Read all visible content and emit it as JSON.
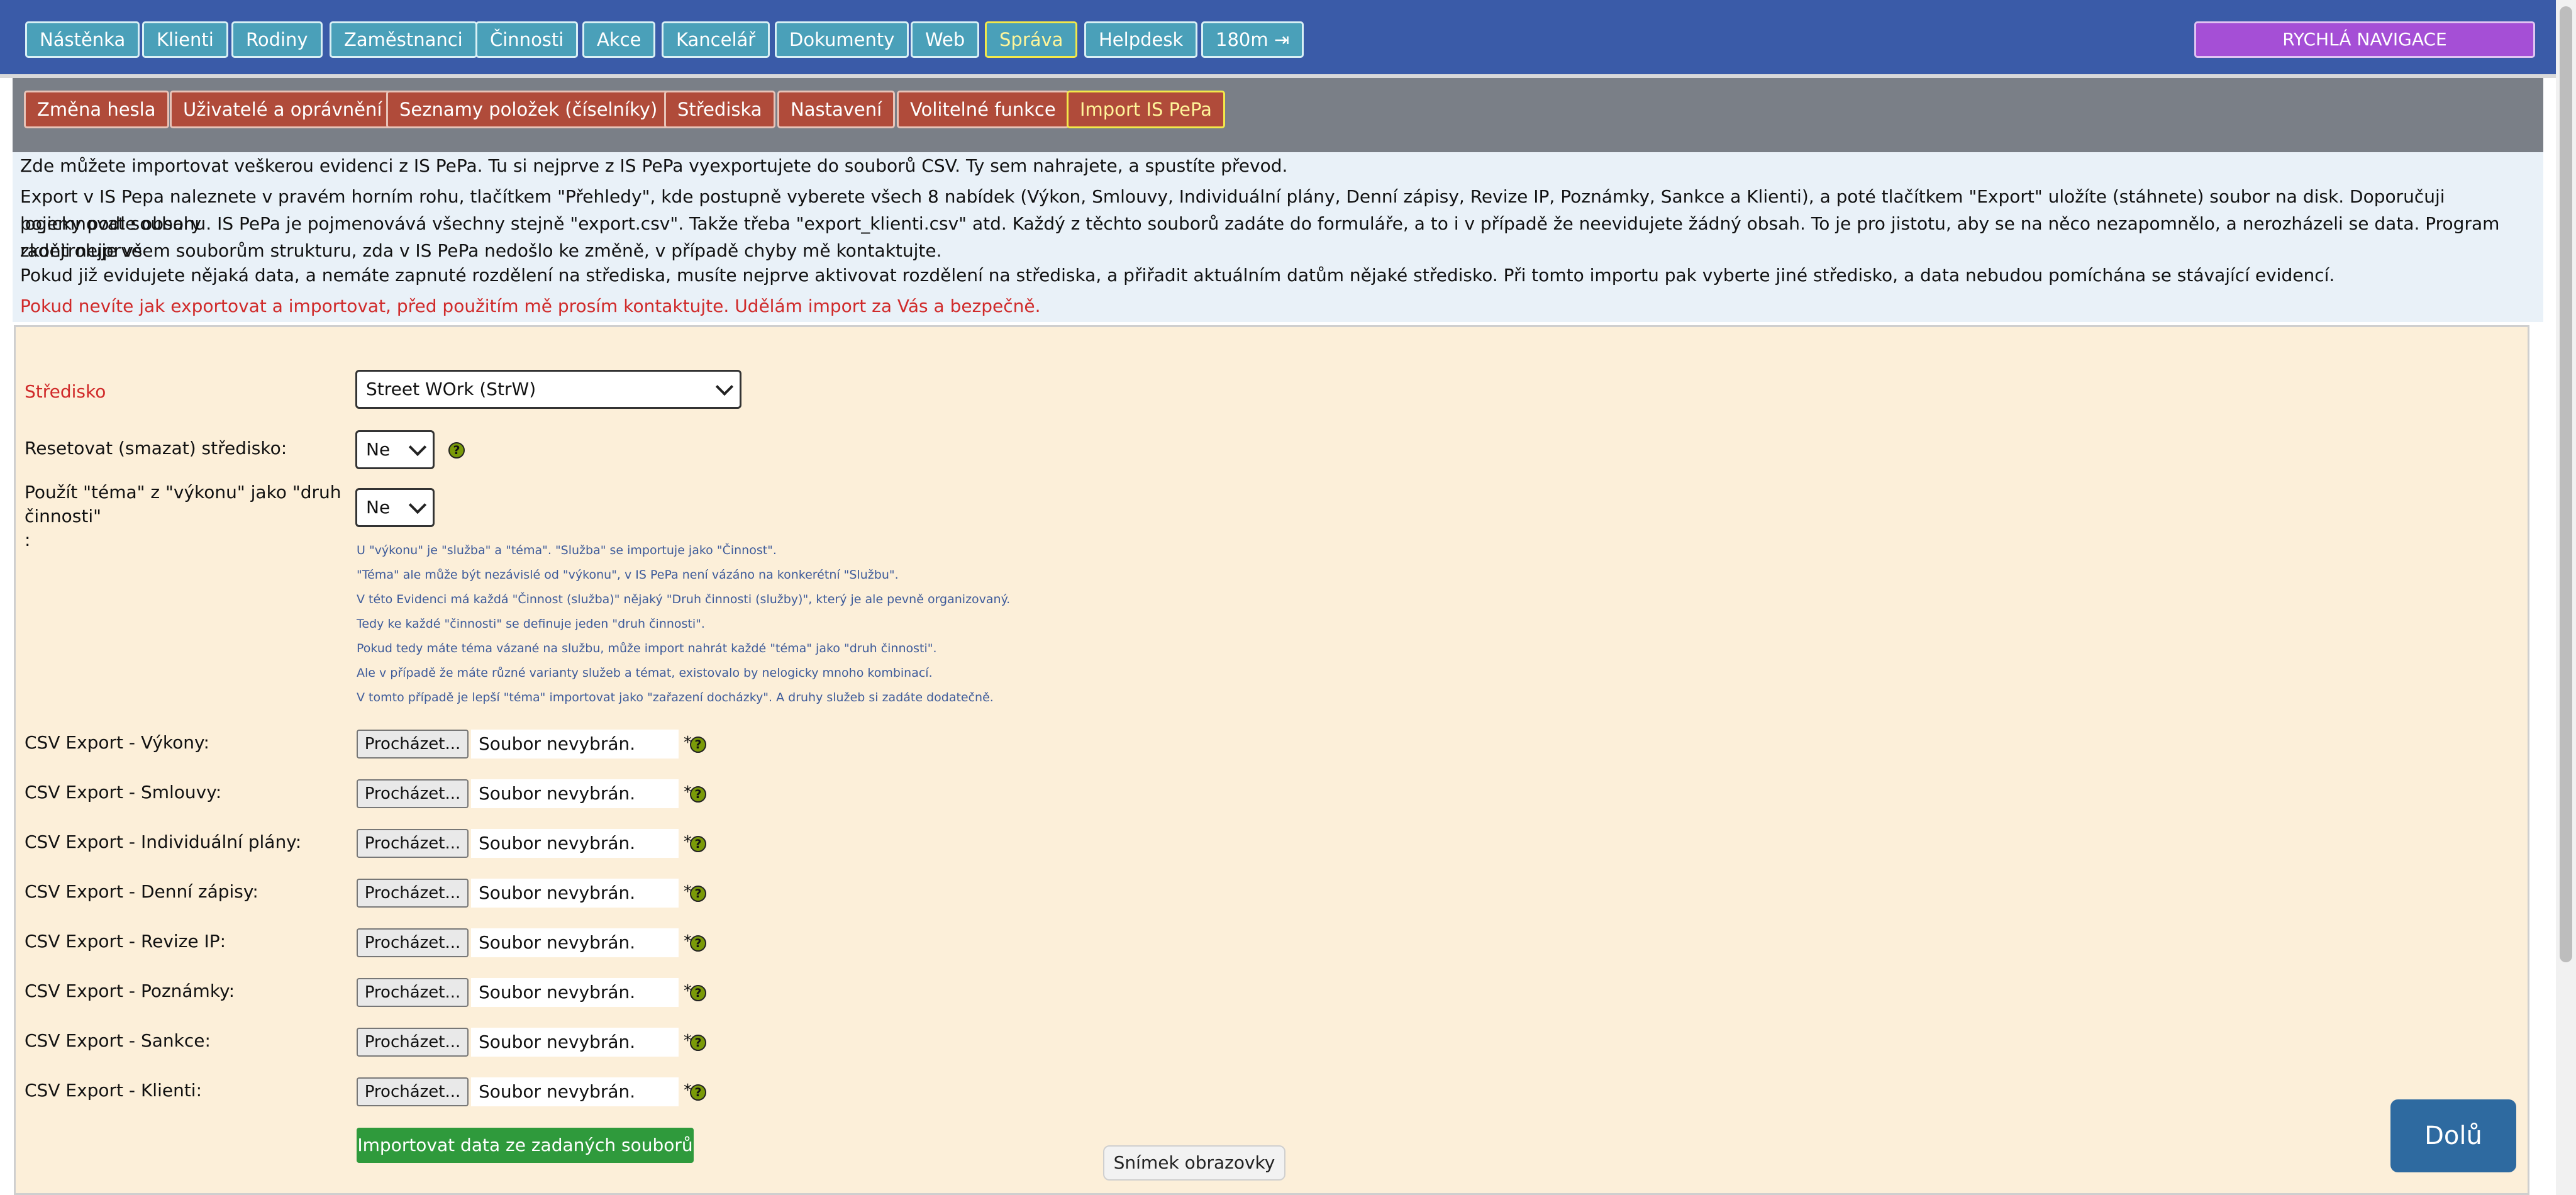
{
  "topnav": {
    "items": [
      {
        "label": "Nástěnka"
      },
      {
        "label": "Klienti"
      },
      {
        "label": "Rodiny"
      },
      {
        "label": "Zaměstnanci"
      },
      {
        "label": "Činnosti"
      },
      {
        "label": "Akce"
      },
      {
        "label": "Kancelář"
      },
      {
        "label": "Dokumenty"
      },
      {
        "label": "Web"
      },
      {
        "label": "Správa"
      },
      {
        "label": "Helpdesk"
      },
      {
        "label": "180m ⇥"
      }
    ],
    "active": "Správa",
    "quick_nav": "RYCHLÁ NAVIGACE"
  },
  "subnav": {
    "items": [
      {
        "label": "Změna hesla"
      },
      {
        "label": "Uživatelé a oprávnění"
      },
      {
        "label": "Seznamy položek (číselníky)"
      },
      {
        "label": "Střediska"
      },
      {
        "label": "Nastavení"
      },
      {
        "label": "Volitelné funkce"
      },
      {
        "label": "Import IS PePa"
      }
    ],
    "active": "Import IS PePa"
  },
  "intro": {
    "p1": "Zde můžete importovat veškerou evidenci z IS PePa. Tu si nejprve z IS PePa vyexportujete do souborů CSV. Ty sem nahrajete, a spustíte převod.",
    "p2_line1": "Export v IS Pepa naleznete v pravém horním rohu, tlačítkem \"Přehledy\", kde postupně vyberete všech 8 nabídek (Výkon, Smlouvy, Individuální plány, Denní zápisy, Revize IP, Poznámky, Sankce a Klienti), a poté tlačítkem \"Export\" uložíte (stáhnete) soubor na disk. Doporučuji pojemnovat soubory",
    "p2_line2": "logicky podle obsahu. IS PePa je pojmenovává všechny stejně \"export.csv\". Takže třeba \"export_klienti.csv\" atd. Každý z těchto souborů zadáte do formuláře, a to i v případě že neevidujete žádný obsah. To je pro jistotu, aby se na něco nezapomnělo, a nerozházeli se data. Program raději nejprve",
    "p2_line3": "zkontroluje všem souborům strukturu, zda v IS PePa nedošlo ke změně, v případě chyby mě kontaktujte.",
    "p3": "Pokud již evidujete nějaká data, a nemáte zapnuté rozdělení na střediska, musíte nejprve aktivovat rozdělení na střediska, a přiřadit aktuálním datům nějaké středisko. Při tomto importu pak vyberte jiné středisko, a data nebudou pomíchána se stávající evidencí.",
    "p4": "Pokud nevíte jak exportovat a importovat, před použitím mě prosím kontaktujte. Udělám import za Vás a bezpečně."
  },
  "form": {
    "stredisko_label": "Středisko",
    "stredisko_value": "Street WOrk (StrW)",
    "reset_label": "Resetovat (smazat) středisko:",
    "reset_value": "Ne",
    "tema_label_line1": "Použít \"téma\" z \"výkonu\" jako \"druh",
    "tema_label_line2": "činnosti\"",
    "tema_label_line3": ":",
    "tema_value": "Ne",
    "notes": [
      "U \"výkonu\" je \"služba\" a \"téma\". \"Služba\" se importuje jako \"Činnost\".",
      "\"Téma\" ale může být nezávislé od \"výkonu\", v IS PePa není vázáno na konkerétní \"Službu\".",
      "V této Evidenci má každá \"Činnost (služba)\" nějaký \"Druh činnosti (služby)\", který je ale pevně organizovaný.",
      "Tedy ke každé \"činnosti\" se definuje jeden \"druh činnosti\".",
      "Pokud tedy máte téma vázané na službu, může import nahrát každé \"téma\" jako \"druh činnosti\".",
      "Ale v případě že máte různé varianty služeb a témat, existovalo by nelogicky mnoho kombinací.",
      "V tomto případě je lepší \"téma\" importovat jako \"zařazení docházky\". A druhy služeb si zadáte dodatečně."
    ],
    "browse_label": "Procházet...",
    "no_file": "Soubor nevybrán.",
    "required_mark": "*",
    "help_glyph": "?",
    "csv_rows": [
      {
        "label": "CSV Export - Výkony:"
      },
      {
        "label": "CSV Export - Smlouvy:"
      },
      {
        "label": "CSV Export - Individuální plány:"
      },
      {
        "label": "CSV Export - Denní zápisy:"
      },
      {
        "label": "CSV Export - Revize IP:"
      },
      {
        "label": "CSV Export - Poznámky:"
      },
      {
        "label": "CSV Export - Sankce:"
      },
      {
        "label": "CSV Export - Klienti:"
      }
    ],
    "import_button": "Importovat data ze zadaných souborů"
  },
  "floating": {
    "down_button": "Dolů",
    "tooltip": "Snímek obrazovky"
  },
  "colors": {
    "topnav_bg": "#3a5ba8",
    "topnav_btn": "#4aa0b9",
    "subnav_btn": "#b04b3a",
    "active_border": "#f3e94a",
    "quicknav": "#a54fd6",
    "panel_bg": "#fcefd9",
    "import_btn": "#2f9a3c",
    "down_btn": "#2e6aa0",
    "warning_text": "#d02a2a"
  }
}
